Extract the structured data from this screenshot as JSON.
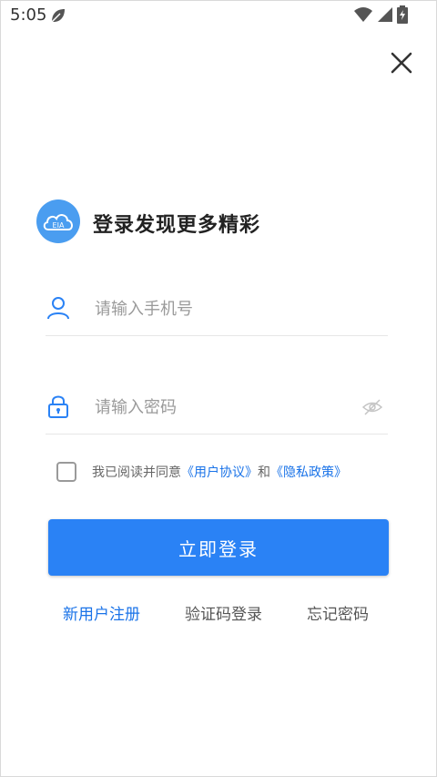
{
  "status_bar": {
    "time": "5:05"
  },
  "brand": {
    "logo_text": "EIA",
    "title": "登录发现更多精彩"
  },
  "form": {
    "phone_placeholder": "请输入手机号",
    "password_placeholder": "请输入密码"
  },
  "agreement": {
    "prefix": "我已阅读并同意",
    "user_agreement": "《用户协议》",
    "conjunction": "和",
    "privacy_policy": "《隐私政策》"
  },
  "login_button": "立即登录",
  "links": {
    "register": "新用户注册",
    "sms_login": "验证码登录",
    "forgot_password": "忘记密码"
  },
  "colors": {
    "accent": "#2a82f5",
    "link": "#1a73e8",
    "logo": "#4a9df0"
  }
}
